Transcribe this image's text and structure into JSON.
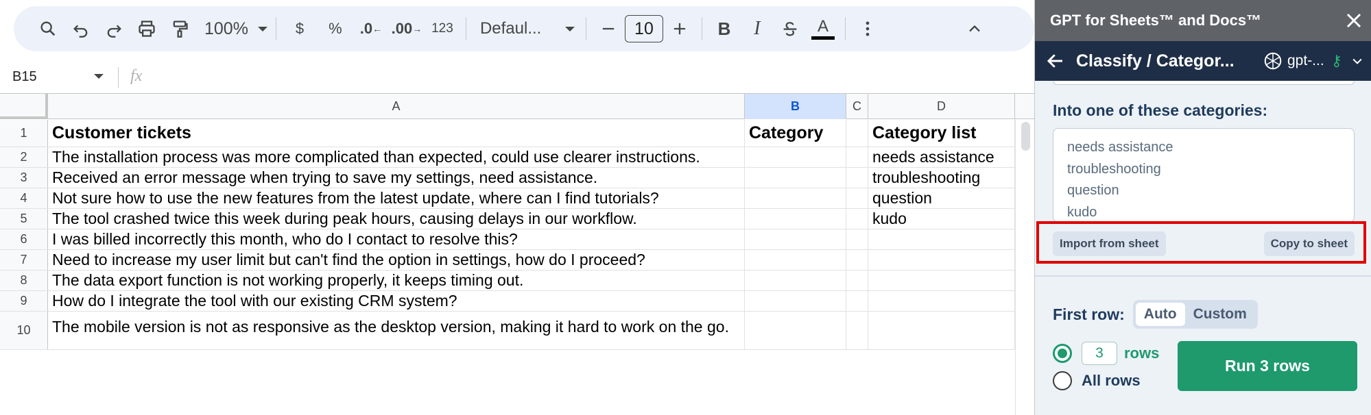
{
  "toolbar": {
    "zoom": "100%",
    "currency": "$",
    "percent": "%",
    "decrease_decimal": ".0",
    "increase_decimal": ".00",
    "number_format": "123",
    "font": "Defaul...",
    "font_size": "10",
    "bold": "B",
    "italic": "I",
    "text_color": "A"
  },
  "formula_bar": {
    "cell_ref": "B15",
    "fx": "fx"
  },
  "columns": [
    {
      "label": "A",
      "selected": false
    },
    {
      "label": "B",
      "selected": true
    },
    {
      "label": "C",
      "selected": false
    },
    {
      "label": "D",
      "selected": false
    }
  ],
  "rows": [
    {
      "n": "1",
      "a": "Customer tickets",
      "b": "Category",
      "c": "",
      "d": "Category list",
      "header": true
    },
    {
      "n": "2",
      "a": "The installation process was more complicated than expected, could use clearer instructions.",
      "b": "",
      "c": "",
      "d": "needs assistance"
    },
    {
      "n": "3",
      "a": "Received an error message when trying to save my settings, need assistance.",
      "b": "",
      "c": "",
      "d": "troubleshooting"
    },
    {
      "n": "4",
      "a": "Not sure how to use the new features from the latest update, where can I find tutorials?",
      "b": "",
      "c": "",
      "d": "question"
    },
    {
      "n": "5",
      "a": "The tool crashed twice this week during peak hours, causing delays in our workflow.",
      "b": "",
      "c": "",
      "d": "kudo"
    },
    {
      "n": "6",
      "a": "I was billed incorrectly this month, who do I contact to resolve this?",
      "b": "",
      "c": "",
      "d": ""
    },
    {
      "n": "7",
      "a": "Need to increase my user limit but can't find the option in settings, how do I proceed?",
      "b": "",
      "c": "",
      "d": ""
    },
    {
      "n": "8",
      "a": "The data export function is not working properly, it keeps timing out.",
      "b": "",
      "c": "",
      "d": ""
    },
    {
      "n": "9",
      "a": "How do I integrate the tool with our existing CRM system?",
      "b": "",
      "c": "",
      "d": ""
    },
    {
      "n": "10",
      "a": "The mobile version is not as responsive as the desktop version, making it hard to work on the go.",
      "b": "",
      "c": "",
      "d": ""
    }
  ],
  "panel": {
    "title": "GPT for Sheets™ and Docs™",
    "nav_title": "Classify / Categor...",
    "model": "gpt-...",
    "categories_label": "Into one of these categories:",
    "categories": [
      "needs assistance",
      "troubleshooting",
      "question",
      "kudo"
    ],
    "import_button": "Import from sheet",
    "copy_button": "Copy to sheet",
    "first_row_label": "First row:",
    "first_row_options": [
      "Auto",
      "Custom"
    ],
    "first_row_selected": "Auto",
    "rows_count": "3",
    "rows_word": "rows",
    "all_rows_label": "All rows",
    "run_button": "Run 3 rows"
  },
  "colors": {
    "accent_green": "#1e9a6d",
    "panel_title_bg": "#5f6368",
    "panel_nav_bg": "#1e2e46",
    "highlight_red": "#e00000",
    "selected_col": "#d3e3fd"
  }
}
